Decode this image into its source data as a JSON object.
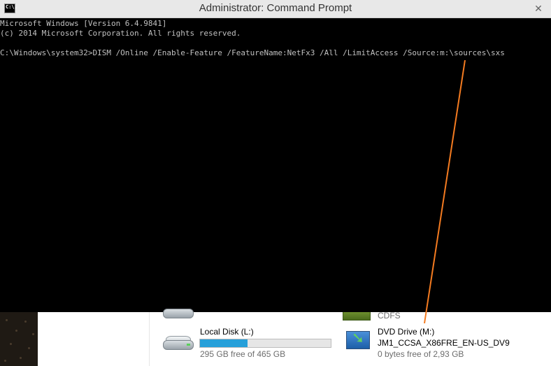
{
  "window": {
    "title": "Administrator: Command Prompt",
    "close_glyph": "✕",
    "icon": "cmd-icon",
    "icon_text": "C:\\."
  },
  "console": {
    "lines": [
      "Microsoft Windows [Version 6.4.9841]",
      "(c) 2014 Microsoft Corporation. All rights reserved.",
      "",
      "C:\\Windows\\system32>DISM /Online /Enable-Feature /FeatureName:NetFx3 /All /LimitAccess /Source:m:\\sources\\sxs"
    ]
  },
  "drives": {
    "cd_partial": {
      "fs": "CDFS"
    },
    "local_disk": {
      "name": "Local Disk (L:)",
      "free_text": "295 GB free of 465 GB",
      "used_fraction": 0.366
    },
    "dvd": {
      "name": "DVD Drive (M:)",
      "label": "JM1_CCSA_X86FRE_EN-US_DV9",
      "free_text": "0 bytes free of 2,93 GB"
    }
  },
  "colors": {
    "console_bg": "#000000",
    "console_fg": "#c0c0c0",
    "annotation": "#f47b20",
    "capacity_fill": "#26a0da"
  }
}
